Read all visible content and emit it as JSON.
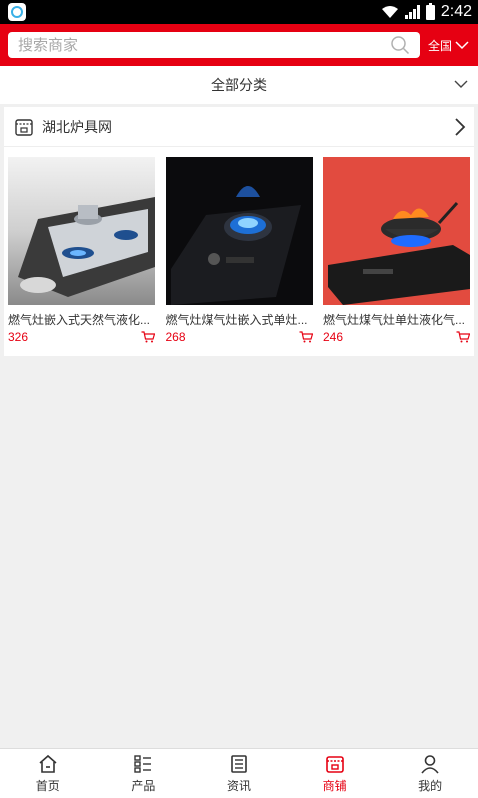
{
  "status_bar": {
    "time": "2:42"
  },
  "header": {
    "search_placeholder": "搜索商家",
    "region_label": "全国"
  },
  "category_bar": {
    "label": "全部分类"
  },
  "store": {
    "name": "湖北炉具网",
    "products": [
      {
        "name": "燃气灶嵌入式天然气液化...",
        "price": "326"
      },
      {
        "name": "燃气灶煤气灶嵌入式单灶...",
        "price": "268"
      },
      {
        "name": "燃气灶煤气灶单灶液化气...",
        "price": "246"
      }
    ]
  },
  "bottom_nav": {
    "items": [
      {
        "label": "首页",
        "icon": "home-icon"
      },
      {
        "label": "产品",
        "icon": "list-icon"
      },
      {
        "label": "资讯",
        "icon": "news-icon"
      },
      {
        "label": "商铺",
        "icon": "shop-icon",
        "active": true
      },
      {
        "label": "我的",
        "icon": "user-icon"
      }
    ]
  },
  "colors": {
    "brand": "#e60012",
    "background": "#f0f0f0"
  }
}
